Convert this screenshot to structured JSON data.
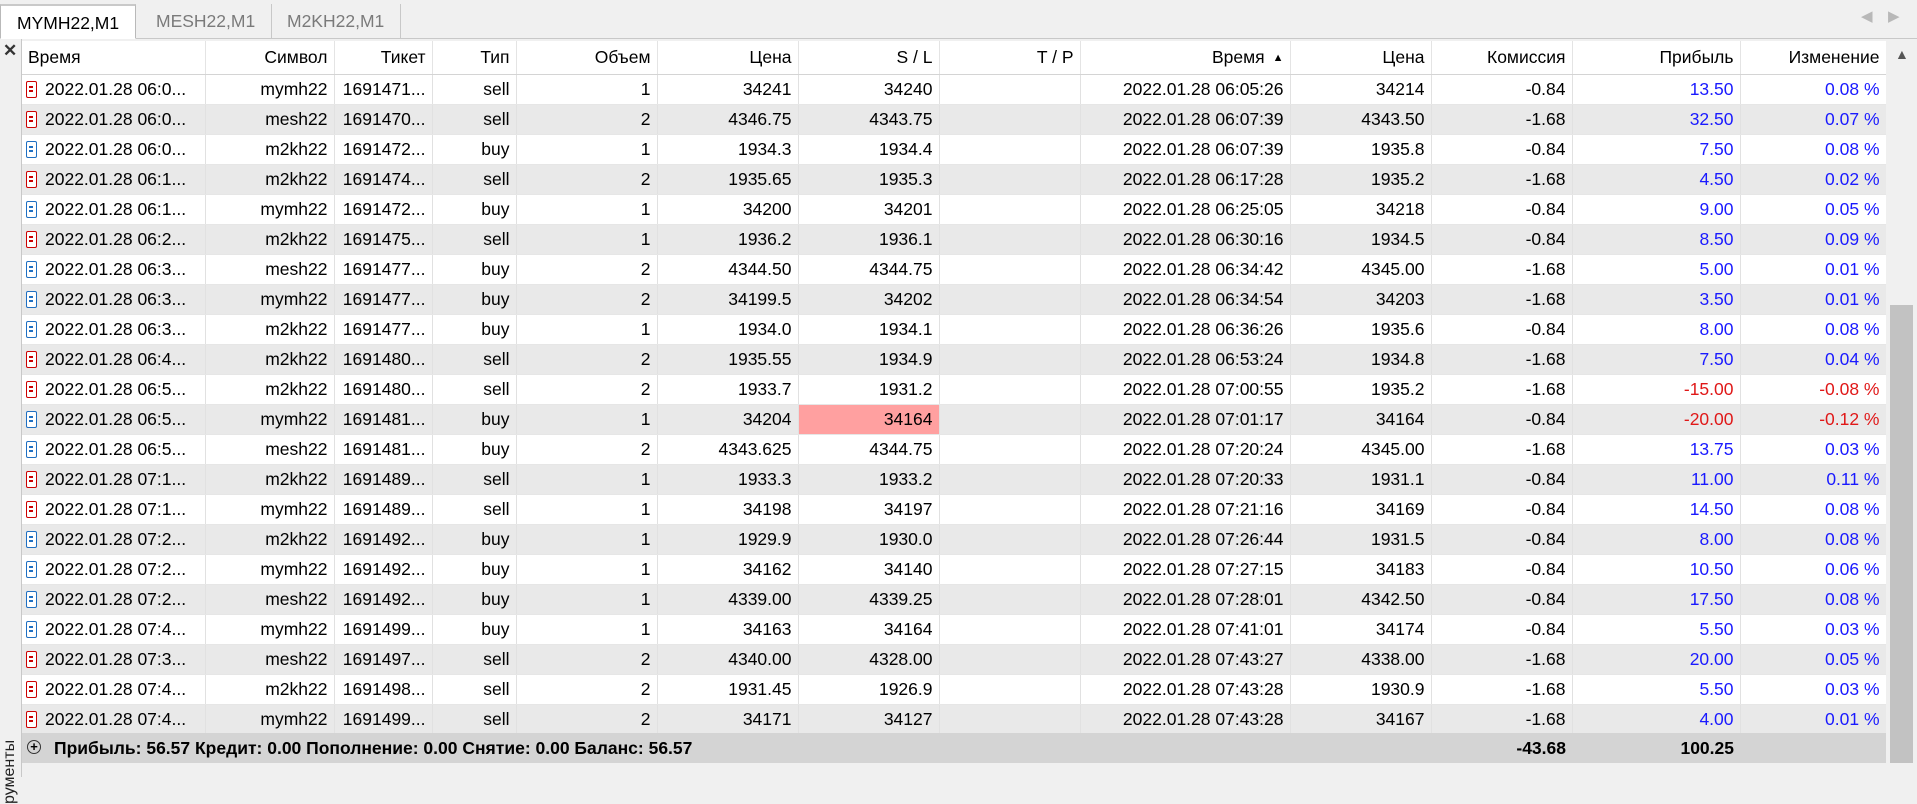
{
  "tabs": [
    {
      "label": "MYMH22,M1",
      "active": true
    },
    {
      "label": "MESH22,M1",
      "active": false
    },
    {
      "label": "M2KH22,M1",
      "active": false
    }
  ],
  "panel_label": "рументы",
  "columns": [
    "Время",
    "Символ",
    "Тикет",
    "Тип",
    "Объем",
    "Цена",
    "S / L",
    "T / P",
    "Время",
    "Цена",
    "Комиссия",
    "Прибыль",
    "Изменение"
  ],
  "sorted_column_index": 8,
  "rows": [
    {
      "time": "2022.01.28 06:0...",
      "symbol": "mymh22",
      "ticket": "1691471...",
      "type": "sell",
      "volume": "1",
      "price": "34241",
      "sl": "34240",
      "tp": "",
      "close_time": "2022.01.28 06:05:26",
      "close_price": "34214",
      "commission": "-0.84",
      "profit": "13.50",
      "change": "0.08 %"
    },
    {
      "time": "2022.01.28 06:0...",
      "symbol": "mesh22",
      "ticket": "1691470...",
      "type": "sell",
      "volume": "2",
      "price": "4346.75",
      "sl": "4343.75",
      "tp": "",
      "close_time": "2022.01.28 06:07:39",
      "close_price": "4343.50",
      "commission": "-1.68",
      "profit": "32.50",
      "change": "0.07 %"
    },
    {
      "time": "2022.01.28 06:0...",
      "symbol": "m2kh22",
      "ticket": "1691472...",
      "type": "buy",
      "volume": "1",
      "price": "1934.3",
      "sl": "1934.4",
      "tp": "",
      "close_time": "2022.01.28 06:07:39",
      "close_price": "1935.8",
      "commission": "-0.84",
      "profit": "7.50",
      "change": "0.08 %"
    },
    {
      "time": "2022.01.28 06:1...",
      "symbol": "m2kh22",
      "ticket": "1691474...",
      "type": "sell",
      "volume": "2",
      "price": "1935.65",
      "sl": "1935.3",
      "tp": "",
      "close_time": "2022.01.28 06:17:28",
      "close_price": "1935.2",
      "commission": "-1.68",
      "profit": "4.50",
      "change": "0.02 %"
    },
    {
      "time": "2022.01.28 06:1...",
      "symbol": "mymh22",
      "ticket": "1691472...",
      "type": "buy",
      "volume": "1",
      "price": "34200",
      "sl": "34201",
      "tp": "",
      "close_time": "2022.01.28 06:25:05",
      "close_price": "34218",
      "commission": "-0.84",
      "profit": "9.00",
      "change": "0.05 %"
    },
    {
      "time": "2022.01.28 06:2...",
      "symbol": "m2kh22",
      "ticket": "1691475...",
      "type": "sell",
      "volume": "1",
      "price": "1936.2",
      "sl": "1936.1",
      "tp": "",
      "close_time": "2022.01.28 06:30:16",
      "close_price": "1934.5",
      "commission": "-0.84",
      "profit": "8.50",
      "change": "0.09 %"
    },
    {
      "time": "2022.01.28 06:3...",
      "symbol": "mesh22",
      "ticket": "1691477...",
      "type": "buy",
      "volume": "2",
      "price": "4344.50",
      "sl": "4344.75",
      "tp": "",
      "close_time": "2022.01.28 06:34:42",
      "close_price": "4345.00",
      "commission": "-1.68",
      "profit": "5.00",
      "change": "0.01 %"
    },
    {
      "time": "2022.01.28 06:3...",
      "symbol": "mymh22",
      "ticket": "1691477...",
      "type": "buy",
      "volume": "2",
      "price": "34199.5",
      "sl": "34202",
      "tp": "",
      "close_time": "2022.01.28 06:34:54",
      "close_price": "34203",
      "commission": "-1.68",
      "profit": "3.50",
      "change": "0.01 %"
    },
    {
      "time": "2022.01.28 06:3...",
      "symbol": "m2kh22",
      "ticket": "1691477...",
      "type": "buy",
      "volume": "1",
      "price": "1934.0",
      "sl": "1934.1",
      "tp": "",
      "close_time": "2022.01.28 06:36:26",
      "close_price": "1935.6",
      "commission": "-0.84",
      "profit": "8.00",
      "change": "0.08 %"
    },
    {
      "time": "2022.01.28 06:4...",
      "symbol": "m2kh22",
      "ticket": "1691480...",
      "type": "sell",
      "volume": "2",
      "price": "1935.55",
      "sl": "1934.9",
      "tp": "",
      "close_time": "2022.01.28 06:53:24",
      "close_price": "1934.8",
      "commission": "-1.68",
      "profit": "7.50",
      "change": "0.04 %"
    },
    {
      "time": "2022.01.28 06:5...",
      "symbol": "m2kh22",
      "ticket": "1691480...",
      "type": "sell",
      "volume": "2",
      "price": "1933.7",
      "sl": "1931.2",
      "tp": "",
      "close_time": "2022.01.28 07:00:55",
      "close_price": "1935.2",
      "commission": "-1.68",
      "profit": "-15.00",
      "change": "-0.08 %"
    },
    {
      "time": "2022.01.28 06:5...",
      "symbol": "mymh22",
      "ticket": "1691481...",
      "type": "buy",
      "volume": "1",
      "price": "34204",
      "sl": "34164",
      "sl_hit": true,
      "tp": "",
      "close_time": "2022.01.28 07:01:17",
      "close_price": "34164",
      "commission": "-0.84",
      "profit": "-20.00",
      "change": "-0.12 %"
    },
    {
      "time": "2022.01.28 06:5...",
      "symbol": "mesh22",
      "ticket": "1691481...",
      "type": "buy",
      "volume": "2",
      "price": "4343.625",
      "sl": "4344.75",
      "tp": "",
      "close_time": "2022.01.28 07:20:24",
      "close_price": "4345.00",
      "commission": "-1.68",
      "profit": "13.75",
      "change": "0.03 %"
    },
    {
      "time": "2022.01.28 07:1...",
      "symbol": "m2kh22",
      "ticket": "1691489...",
      "type": "sell",
      "volume": "1",
      "price": "1933.3",
      "sl": "1933.2",
      "tp": "",
      "close_time": "2022.01.28 07:20:33",
      "close_price": "1931.1",
      "commission": "-0.84",
      "profit": "11.00",
      "change": "0.11 %"
    },
    {
      "time": "2022.01.28 07:1...",
      "symbol": "mymh22",
      "ticket": "1691489...",
      "type": "sell",
      "volume": "1",
      "price": "34198",
      "sl": "34197",
      "tp": "",
      "close_time": "2022.01.28 07:21:16",
      "close_price": "34169",
      "commission": "-0.84",
      "profit": "14.50",
      "change": "0.08 %"
    },
    {
      "time": "2022.01.28 07:2...",
      "symbol": "m2kh22",
      "ticket": "1691492...",
      "type": "buy",
      "volume": "1",
      "price": "1929.9",
      "sl": "1930.0",
      "tp": "",
      "close_time": "2022.01.28 07:26:44",
      "close_price": "1931.5",
      "commission": "-0.84",
      "profit": "8.00",
      "change": "0.08 %"
    },
    {
      "time": "2022.01.28 07:2...",
      "symbol": "mymh22",
      "ticket": "1691492...",
      "type": "buy",
      "volume": "1",
      "price": "34162",
      "sl": "34140",
      "tp": "",
      "close_time": "2022.01.28 07:27:15",
      "close_price": "34183",
      "commission": "-0.84",
      "profit": "10.50",
      "change": "0.06 %"
    },
    {
      "time": "2022.01.28 07:2...",
      "symbol": "mesh22",
      "ticket": "1691492...",
      "type": "buy",
      "volume": "1",
      "price": "4339.00",
      "sl": "4339.25",
      "tp": "",
      "close_time": "2022.01.28 07:28:01",
      "close_price": "4342.50",
      "commission": "-0.84",
      "profit": "17.50",
      "change": "0.08 %"
    },
    {
      "time": "2022.01.28 07:4...",
      "symbol": "mymh22",
      "ticket": "1691499...",
      "type": "buy",
      "volume": "1",
      "price": "34163",
      "sl": "34164",
      "tp": "",
      "close_time": "2022.01.28 07:41:01",
      "close_price": "34174",
      "commission": "-0.84",
      "profit": "5.50",
      "change": "0.03 %"
    },
    {
      "time": "2022.01.28 07:3...",
      "symbol": "mesh22",
      "ticket": "1691497...",
      "type": "sell",
      "volume": "2",
      "price": "4340.00",
      "sl": "4328.00",
      "tp": "",
      "close_time": "2022.01.28 07:43:27",
      "close_price": "4338.00",
      "commission": "-1.68",
      "profit": "20.00",
      "change": "0.05 %"
    },
    {
      "time": "2022.01.28 07:4...",
      "symbol": "m2kh22",
      "ticket": "1691498...",
      "type": "sell",
      "volume": "2",
      "price": "1931.45",
      "sl": "1926.9",
      "tp": "",
      "close_time": "2022.01.28 07:43:28",
      "close_price": "1930.9",
      "commission": "-1.68",
      "profit": "5.50",
      "change": "0.03 %"
    },
    {
      "time": "2022.01.28 07:4...",
      "symbol": "mymh22",
      "ticket": "1691499...",
      "type": "sell",
      "volume": "2",
      "price": "34171",
      "sl": "34127",
      "tp": "",
      "close_time": "2022.01.28 07:43:28",
      "close_price": "34167",
      "commission": "-1.68",
      "profit": "4.00",
      "change": "0.01 %"
    }
  ],
  "summary": {
    "text": "Прибыль: 56.57  Кредит: 0.00  Пополнение: 0.00  Снятие: 0.00  Баланс: 56.57",
    "commission_total": "-43.68",
    "profit_total": "100.25"
  },
  "colors": {
    "profit_positive": "#1a1aff",
    "profit_negative": "#e01818",
    "sell_icon": "#cc0000",
    "buy_icon": "#1e6fc2",
    "sl_hit_bg": "#ffa0a0"
  },
  "icons": {
    "sell_row": "sell-order-icon",
    "buy_row": "buy-order-icon",
    "close": "close-icon",
    "expand": "plus-circle-icon",
    "sort": "sort-ascending-icon",
    "scroll_up": "chevron-up-icon"
  }
}
